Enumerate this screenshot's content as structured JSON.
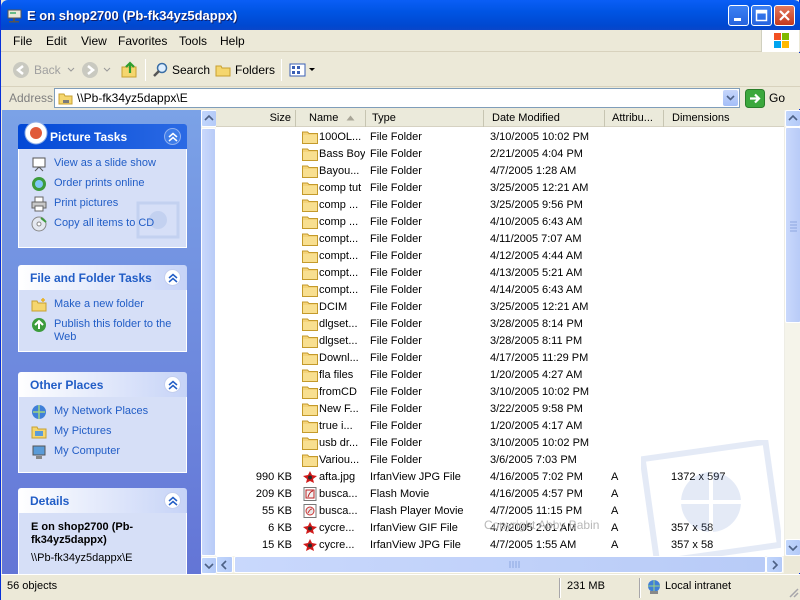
{
  "window": {
    "title": "E on shop2700 (Pb-fk34yz5dappx)"
  },
  "menu": [
    "File",
    "Edit",
    "View",
    "Favorites",
    "Tools",
    "Help"
  ],
  "toolbar": {
    "back": "Back",
    "search": "Search",
    "folders": "Folders"
  },
  "address": {
    "label": "Address",
    "value": "\\\\Pb-fk34yz5dappx\\E",
    "go": "Go"
  },
  "panels": {
    "picture_tasks": {
      "title": "Picture Tasks",
      "items": [
        "View as a slide show",
        "Order prints online",
        "Print pictures",
        "Copy all items to CD"
      ]
    },
    "file_folder_tasks": {
      "title": "File and Folder Tasks",
      "items": [
        "Make a new folder",
        "Publish this folder to the Web"
      ]
    },
    "other_places": {
      "title": "Other Places",
      "items": [
        "My Network Places",
        "My Pictures",
        "My Computer"
      ]
    },
    "details": {
      "title": "Details",
      "name": "E on shop2700 (Pb-fk34yz5dappx)",
      "path": "\\\\Pb-fk34yz5dappx\\E"
    }
  },
  "columns": {
    "size": "Size",
    "name": "Name",
    "type": "Type",
    "date": "Date Modified",
    "attr": "Attribu...",
    "dims": "Dimensions"
  },
  "files": [
    {
      "size": "",
      "name": "100OL...",
      "type": "File Folder",
      "date": "3/10/2005 10:02 PM",
      "attr": "",
      "dims": "",
      "icon": "folder-icon"
    },
    {
      "size": "",
      "name": "Bass Boy",
      "type": "File Folder",
      "date": "2/21/2005 4:04 PM",
      "attr": "",
      "dims": "",
      "icon": "folder-icon"
    },
    {
      "size": "",
      "name": "Bayou...",
      "type": "File Folder",
      "date": "4/7/2005 1:28 AM",
      "attr": "",
      "dims": "",
      "icon": "folder-icon"
    },
    {
      "size": "",
      "name": "comp tut",
      "type": "File Folder",
      "date": "3/25/2005 12:21 AM",
      "attr": "",
      "dims": "",
      "icon": "folder-icon"
    },
    {
      "size": "",
      "name": "comp ...",
      "type": "File Folder",
      "date": "3/25/2005 9:56 PM",
      "attr": "",
      "dims": "",
      "icon": "folder-icon"
    },
    {
      "size": "",
      "name": "comp ...",
      "type": "File Folder",
      "date": "4/10/2005 6:43 AM",
      "attr": "",
      "dims": "",
      "icon": "folder-icon"
    },
    {
      "size": "",
      "name": "compt...",
      "type": "File Folder",
      "date": "4/11/2005 7:07 AM",
      "attr": "",
      "dims": "",
      "icon": "folder-icon"
    },
    {
      "size": "",
      "name": "compt...",
      "type": "File Folder",
      "date": "4/12/2005 4:44 AM",
      "attr": "",
      "dims": "",
      "icon": "folder-icon"
    },
    {
      "size": "",
      "name": "compt...",
      "type": "File Folder",
      "date": "4/13/2005 5:21 AM",
      "attr": "",
      "dims": "",
      "icon": "folder-icon"
    },
    {
      "size": "",
      "name": "compt...",
      "type": "File Folder",
      "date": "4/14/2005 6:43 AM",
      "attr": "",
      "dims": "",
      "icon": "folder-icon"
    },
    {
      "size": "",
      "name": "DCIM",
      "type": "File Folder",
      "date": "3/25/2005 12:21 AM",
      "attr": "",
      "dims": "",
      "icon": "folder-icon"
    },
    {
      "size": "",
      "name": "dlgset...",
      "type": "File Folder",
      "date": "3/28/2005 8:14 PM",
      "attr": "",
      "dims": "",
      "icon": "folder-icon"
    },
    {
      "size": "",
      "name": "dlgset...",
      "type": "File Folder",
      "date": "3/28/2005 8:11 PM",
      "attr": "",
      "dims": "",
      "icon": "folder-icon"
    },
    {
      "size": "",
      "name": "Downl...",
      "type": "File Folder",
      "date": "4/17/2005 11:29 PM",
      "attr": "",
      "dims": "",
      "icon": "folder-icon"
    },
    {
      "size": "",
      "name": "fla files",
      "type": "File Folder",
      "date": "1/20/2005 4:27 AM",
      "attr": "",
      "dims": "",
      "icon": "folder-icon"
    },
    {
      "size": "",
      "name": "fromCD",
      "type": "File Folder",
      "date": "3/10/2005 10:02 PM",
      "attr": "",
      "dims": "",
      "icon": "folder-icon"
    },
    {
      "size": "",
      "name": "New F...",
      "type": "File Folder",
      "date": "3/22/2005 9:58 PM",
      "attr": "",
      "dims": "",
      "icon": "folder-icon"
    },
    {
      "size": "",
      "name": "true i...",
      "type": "File Folder",
      "date": "1/20/2005 4:17 AM",
      "attr": "",
      "dims": "",
      "icon": "folder-icon"
    },
    {
      "size": "",
      "name": "usb dr...",
      "type": "File Folder",
      "date": "3/10/2005 10:02 PM",
      "attr": "",
      "dims": "",
      "icon": "folder-icon"
    },
    {
      "size": "",
      "name": "Variou...",
      "type": "File Folder",
      "date": "3/6/2005 7:03 PM",
      "attr": "",
      "dims": "",
      "icon": "folder-icon"
    },
    {
      "size": "990 KB",
      "name": "afta.jpg",
      "type": "IrfanView JPG File",
      "date": "4/16/2005 7:02 PM",
      "attr": "A",
      "dims": "1372 x 597",
      "icon": "irfanview-icon"
    },
    {
      "size": "209 KB",
      "name": "busca...",
      "type": "Flash Movie",
      "date": "4/16/2005 4:57 PM",
      "attr": "A",
      "dims": "",
      "icon": "flash-icon"
    },
    {
      "size": "55 KB",
      "name": "busca...",
      "type": "Flash Player Movie",
      "date": "4/7/2005 11:15 PM",
      "attr": "A",
      "dims": "",
      "icon": "flash-player-icon"
    },
    {
      "size": "6 KB",
      "name": "cycre...",
      "type": "IrfanView GIF File",
      "date": "4/7/2005 2:01 AM",
      "attr": "A",
      "dims": "357 x 58",
      "icon": "irfanview-icon"
    },
    {
      "size": "15 KB",
      "name": "cycre...",
      "type": "IrfanView JPG File",
      "date": "4/7/2005 1:55 AM",
      "attr": "A",
      "dims": "357 x 58",
      "icon": "irfanview-icon"
    }
  ],
  "watermark_text": "Copyright Abby Babin",
  "status": {
    "objects": "56 objects",
    "size": "231 MB",
    "zone": "Local intranet"
  }
}
